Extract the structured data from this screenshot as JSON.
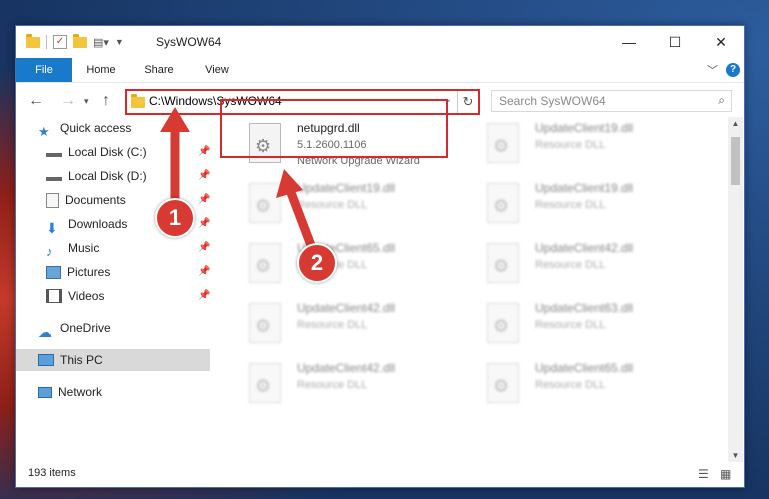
{
  "window": {
    "title": "SysWOW64"
  },
  "ribbon": {
    "tabs": [
      "File",
      "Home",
      "Share",
      "View"
    ]
  },
  "address": {
    "path": "C:\\Windows\\SysWOW64"
  },
  "search": {
    "placeholder": "Search SysWOW64"
  },
  "nav_pane": {
    "items": [
      {
        "label": "Quick access",
        "icon": "star-icon"
      },
      {
        "label": "Local Disk (C:)",
        "icon": "drive-icon",
        "pinned": true
      },
      {
        "label": "Local Disk (D:)",
        "icon": "drive-icon",
        "pinned": true
      },
      {
        "label": "Documents",
        "icon": "documents-icon",
        "pinned": true
      },
      {
        "label": "Downloads",
        "icon": "download-icon",
        "pinned": true
      },
      {
        "label": "Music",
        "icon": "music-icon",
        "pinned": true
      },
      {
        "label": "Pictures",
        "icon": "pictures-icon",
        "pinned": true
      },
      {
        "label": "Videos",
        "icon": "videos-icon",
        "pinned": true
      },
      {
        "label": "OneDrive",
        "icon": "cloud-icon"
      },
      {
        "label": "This PC",
        "icon": "computer-icon",
        "selected": true
      },
      {
        "label": "Network",
        "icon": "network-icon"
      }
    ]
  },
  "files": [
    {
      "name": "netupgrd.dll",
      "version": "5.1.2600.1106",
      "description": "Network Upgrade Wizard",
      "highlighted": true
    },
    {
      "name": "UpdateClient19.dll",
      "description": "Resource DLL"
    },
    {
      "name": "UpdateClient19.dll",
      "description": "Resource DLL"
    },
    {
      "name": "UpdateClient19.dll",
      "description": "Resource DLL"
    },
    {
      "name": "UpdateClient65.dll",
      "description": "Resource DLL"
    },
    {
      "name": "UpdateClient42.dll",
      "description": "Resource DLL"
    },
    {
      "name": "UpdateClient42.dll",
      "description": "Resource DLL"
    },
    {
      "name": "UpdateClient63.dll",
      "description": "Resource DLL"
    },
    {
      "name": "UpdateClient42.dll",
      "description": "Resource DLL"
    },
    {
      "name": "UpdateClient65.dll",
      "description": "Resource DLL"
    }
  ],
  "status": {
    "item_count": "193 items"
  },
  "callouts": [
    "1",
    "2"
  ],
  "colors": {
    "accent": "#1979ca",
    "highlight": "#d62a2a",
    "callout": "#d63a32"
  }
}
